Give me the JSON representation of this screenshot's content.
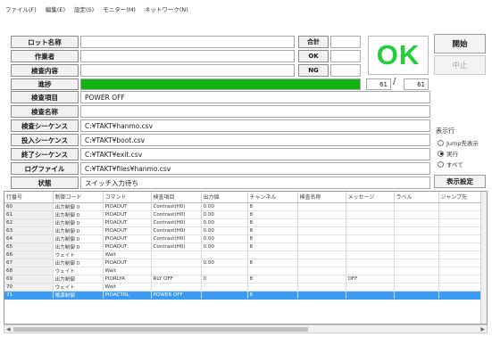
{
  "menu": [
    "ファイル(F)",
    "編集(E)",
    "設定(S)",
    "モニター(M)",
    "ネットワーク(N)"
  ],
  "form": {
    "lot_name": {
      "label": "ロット名称",
      "value": ""
    },
    "worker": {
      "label": "作業者",
      "value": ""
    },
    "inspection_content": {
      "label": "検査内容",
      "value": ""
    },
    "progress": {
      "label": "進捗",
      "fraction": 1.0,
      "current": "61",
      "total": "61"
    },
    "inspection_item": {
      "label": "検査項目",
      "value": "POWER OFF"
    },
    "inspection_name": {
      "label": "検査名称",
      "value": ""
    },
    "inspection_sequence": {
      "label": "検査シーケンス",
      "value": "C:¥TAKT¥hanmo.csv"
    },
    "input_sequence": {
      "label": "投入シーケンス",
      "value": "C:¥TAKT¥boot.csv"
    },
    "end_sequence": {
      "label": "終了シーケンス",
      "value": "C:¥TAKT¥exit.csv"
    },
    "log_file": {
      "label": "ログファイル",
      "value": "C:¥TAKT¥files¥hanmo.csv"
    },
    "status": {
      "label": "状態",
      "value": "スイッチ入力待ち"
    }
  },
  "totals": {
    "total": {
      "label": "合計",
      "value": ""
    },
    "ok": {
      "label": "OK",
      "value": ""
    },
    "ng": {
      "label": "NG",
      "value": ""
    }
  },
  "result": "OK",
  "buttons": {
    "start": "開始",
    "abort": "中止",
    "display_settings": "表示設定"
  },
  "display_mode": {
    "title": "表示行",
    "options": [
      {
        "label": "Jump先表示",
        "selected": false
      },
      {
        "label": "実行",
        "selected": true
      },
      {
        "label": "すべて",
        "selected": false
      }
    ]
  },
  "table": {
    "columns": [
      "行番号",
      "制御コード",
      "コマンド",
      "検査項目",
      "出力値",
      "チャンネル",
      "検査名称",
      "メッセージ",
      "ラベル",
      "ジャンプ先"
    ],
    "rows": [
      [
        "60",
        "出力制御 0",
        "PIOAOUT",
        "Contrast(H0)",
        "0.00",
        "8",
        "",
        "",
        "",
        ""
      ],
      [
        "61",
        "出力制御 0",
        "PIOAOUT",
        "Contrast(H0)",
        "0.00",
        "8",
        "",
        "",
        "",
        ""
      ],
      [
        "62",
        "出力制御 0",
        "PIOAOUT",
        "Contrast(H0)",
        "0.00",
        "8",
        "",
        "",
        "",
        ""
      ],
      [
        "63",
        "出力制御 0",
        "PIOAOUT",
        "Contrast(H0)",
        "0.00",
        "8",
        "",
        "",
        "",
        ""
      ],
      [
        "64",
        "出力制御 0",
        "PIOAOUT",
        "Contrast(H0)",
        "0.00",
        "8",
        "",
        "",
        "",
        ""
      ],
      [
        "65",
        "出力制御 0",
        "PIOAOUT",
        "Contrast(H0)",
        "0.00",
        "8",
        "",
        "",
        "",
        ""
      ],
      [
        "66",
        "ウェイト",
        "Wait",
        "",
        "",
        "",
        "",
        "",
        "",
        ""
      ],
      [
        "67",
        "出力制御 0",
        "PIOAOUT",
        "",
        "0.00",
        "8",
        "",
        "",
        "",
        ""
      ],
      [
        "68",
        "ウェイト",
        "Wait",
        "",
        "",
        "",
        "",
        "",
        "",
        ""
      ],
      [
        "69",
        "出力制御",
        "PIORLYA",
        "RLY OFF",
        "0",
        "8",
        "",
        "OFF",
        "",
        ""
      ],
      [
        "70",
        "ウェイト",
        "Wait",
        "",
        "",
        "",
        "",
        "",
        "",
        ""
      ],
      [
        "71",
        "電源制御",
        "PIOACTRL",
        "POWER OFF",
        "",
        "8",
        "",
        "",
        "",
        ""
      ]
    ],
    "selected_row": 11
  }
}
